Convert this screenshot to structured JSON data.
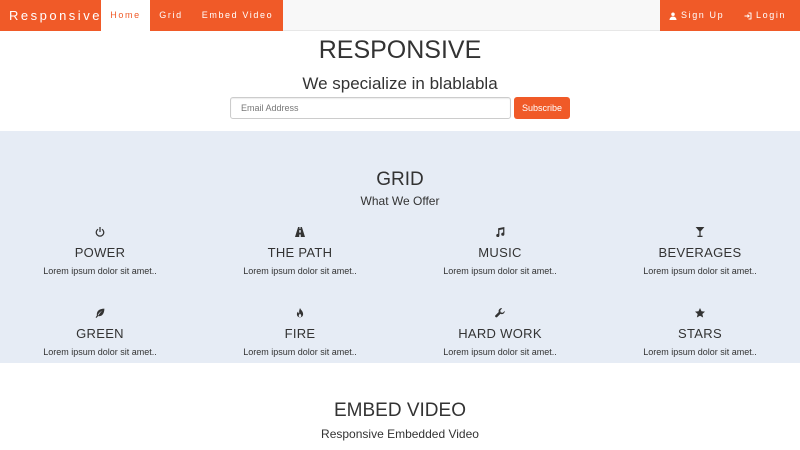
{
  "navbar": {
    "brand": "Responsive",
    "left_items": [
      {
        "label": "Home",
        "active": true
      },
      {
        "label": "Grid",
        "active": false
      },
      {
        "label": "Embed Video",
        "active": false
      }
    ],
    "right_items": [
      {
        "label": "Sign Up",
        "icon": "user-icon"
      },
      {
        "label": "Login",
        "icon": "login-icon"
      }
    ]
  },
  "hero": {
    "title": "RESPONSIVE",
    "subtitle": "We specialize in blablabla",
    "email_placeholder": "Email Address",
    "email_value": "",
    "subscribe_label": "Subscribe"
  },
  "grid": {
    "title": "GRID",
    "subtitle": "What We Offer",
    "items": [
      {
        "icon": "power-icon",
        "title": "POWER",
        "text": "Lorem ipsum dolor sit amet.."
      },
      {
        "icon": "road-icon",
        "title": "THE PATH",
        "text": "Lorem ipsum dolor sit amet.."
      },
      {
        "icon": "music-icon",
        "title": "MUSIC",
        "text": "Lorem ipsum dolor sit amet.."
      },
      {
        "icon": "glass-icon",
        "title": "BEVERAGES",
        "text": "Lorem ipsum dolor sit amet.."
      },
      {
        "icon": "leaf-icon",
        "title": "GREEN",
        "text": "Lorem ipsum dolor sit amet.."
      },
      {
        "icon": "fire-icon",
        "title": "FIRE",
        "text": "Lorem ipsum dolor sit amet.."
      },
      {
        "icon": "wrench-icon",
        "title": "HARD WORK",
        "text": "Lorem ipsum dolor sit amet.."
      },
      {
        "icon": "star-icon",
        "title": "STARS",
        "text": "Lorem ipsum dolor sit amet.."
      }
    ]
  },
  "video": {
    "title": "EMBED VIDEO",
    "subtitle": "Responsive Embedded Video"
  },
  "colors": {
    "accent": "#f05a28",
    "grid_background": "#e6ecf5",
    "navbar_background": "#f8f8f8"
  }
}
